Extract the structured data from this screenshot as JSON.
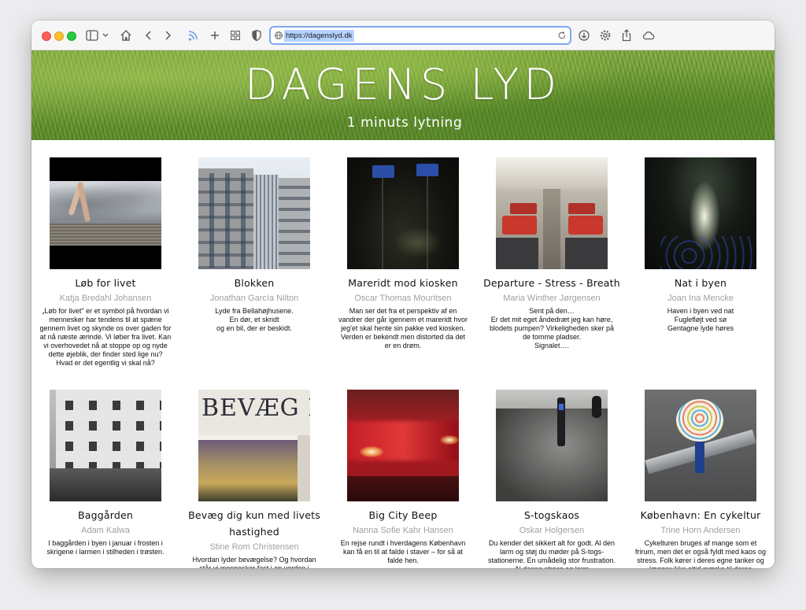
{
  "browser": {
    "url": "https://dagenslyd.dk"
  },
  "site": {
    "title": "DAGENS LYD",
    "subtitle": "1 minuts lytning"
  },
  "cards": [
    {
      "title": "Løb for livet",
      "author": "Katja Bredahl Johansen",
      "description": "„Løb for livet\" er et symbol på hvordan vi mennesker har tendens til at spæne gennem livet og skynde os over gaden for at nå næste ærinde. Vi løber fra livet. Kan vi overhovedet nå at stoppe op og nyde dette øjeblik, der finder sted lige nu? Hvad er det egentlig vi skal nå?"
    },
    {
      "title": "Blokken",
      "author": "Jonathan García Nilton",
      "description": "Lyde fra Bellahøjhusene.\nEn dør, et skridt\nog en bil, der er beskidt."
    },
    {
      "title": "Mareridt mod kiosken",
      "author": "Oscar Thomas Mouritsen",
      "description": "Man ser det fra et perspektiv af en vandrer der går igennem et mareridt hvor jeg'et skal hente sin pakke ved kiosken. Verden er bekendt men distorted da det er en drøm."
    },
    {
      "title": "Departure - Stress - Breath",
      "author": "Maria Winther Jørgensen",
      "description": "Sent på den…\nEr det mit eget åndedræt jeg kan høre, blodets pumpen? Virkeligheden sker på de tomme pladser.\nSignalet…."
    },
    {
      "title": "Nat i byen",
      "author": "Joan Ina Mencke",
      "description": "Haven i byen ved nat\nFuglefløjt ved sø\nGentagne lyde høres"
    },
    {
      "title": "Baggården",
      "author": "Adam Kalwa",
      "description": "I baggården i byen i januar i frosten i skrigene i larmen i stilheden i trøsten."
    },
    {
      "title": "Bevæg dig kun med livets hastighed",
      "author": "Stine Rom Christensen",
      "description": "Hvordan lyder bevægelse? Og hvordan står vi mennesker fast i en verden i"
    },
    {
      "title": "Big City Beep",
      "author": "Nanna Sofie Kahr Hansen",
      "description": "En rejse rundt i hverdagens København kan få en til at falde i staver – for så at falde hen."
    },
    {
      "title": "S-togskaos",
      "author": "Oskar Holgersen",
      "description": "Du kender det sikkert alt for godt. Al den larm og støj du møder på S-togs-stationerne. En umådelig stor frustration. Al denne stress og larm"
    },
    {
      "title": "København: En cykeltur",
      "author": "Trine Horn Andersen",
      "description": "Cykelturen bruges af mange som et frirum, men det er også fyldt med kaos og stress. Folk kører i deres egne tanker og lægger ikke altid mærke til deres"
    }
  ],
  "thumb_sign_text": "BEVÆG D",
  "colors": {
    "accent_focus": "#7ea7f0",
    "url_highlight": "#b5d3ff",
    "author_gray": "#a0a0a0",
    "banner_green": "#6e9a35"
  },
  "icons": [
    "sidebar-icon",
    "chevron-down-icon",
    "home-icon",
    "back-icon",
    "forward-icon",
    "rss-icon",
    "plus-icon",
    "grid-icon",
    "shield-icon",
    "globe-icon",
    "reload-icon",
    "download-icon",
    "gear-icon",
    "share-icon",
    "cloud-icon"
  ]
}
